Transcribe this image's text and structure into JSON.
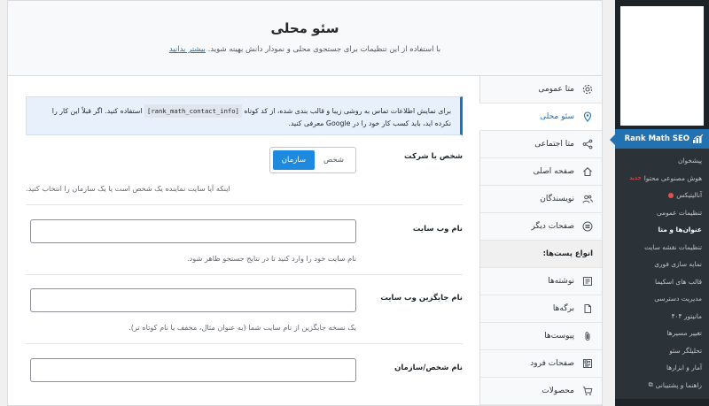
{
  "admin_menu": {
    "plugin_name": "Rank Math SEO",
    "items": [
      {
        "label": "پیشخوان"
      },
      {
        "label": "هوش مصنوعی محتوا",
        "badge": "جدید"
      },
      {
        "label": "آنالیتیکس"
      },
      {
        "label": "تنظیمات عمومی"
      },
      {
        "label": "عنوان‌ها و متا"
      },
      {
        "label": "تنظیمات نقشه سایت"
      },
      {
        "label": "نمایه سازی فوری"
      },
      {
        "label": "قالب های اسکیما"
      },
      {
        "label": "مدیریت دسترسی"
      },
      {
        "label": "مانیتور ۴۰۴"
      },
      {
        "label": "تغییر مسیرها"
      },
      {
        "label": "تحلیلگر سئو"
      },
      {
        "label": "آمار و ابزارها"
      },
      {
        "label": "راهنما و پشتیبانی"
      }
    ]
  },
  "header": {
    "title": "سئو محلی",
    "subtitle": "با استفاده از این تنظیمات برای جستجوی محلی و نمودار دانش بهینه شوید.",
    "learn_more": "بیشتر بدانید"
  },
  "tabs": [
    {
      "label": "متا عمومی",
      "icon": "gear-icon"
    },
    {
      "label": "سئو محلی",
      "icon": "map-pin-icon"
    },
    {
      "label": "متا اجتماعی",
      "icon": "share-icon"
    },
    {
      "label": "صفحه اصلی",
      "icon": "home-icon"
    },
    {
      "label": "نویسندگان",
      "icon": "users-icon"
    },
    {
      "label": "صفحات دیگر",
      "icon": "list-circle-icon"
    },
    {
      "label": "انواع پست‌ها:"
    },
    {
      "label": "نوشته‌ها",
      "icon": "document-icon"
    },
    {
      "label": "برگه‌ها",
      "icon": "page-icon"
    },
    {
      "label": "پیوست‌ها",
      "icon": "paperclip-icon"
    },
    {
      "label": "صفحات فرود",
      "icon": "landing-page-icon"
    },
    {
      "label": "محصولات",
      "icon": "cart-icon"
    }
  ],
  "notice": {
    "text_before": "برای نمایش اطلاعات تماس به روشی زیبا و قالب بندی شده، از کد کوتاه",
    "code": "[rank_math_contact_info]",
    "text_after": "استفاده کنید. اگر قبلاً این کار را نکرده اید، باید کسب کار خود را در Google معرفی کنید."
  },
  "fields": {
    "entity": {
      "label": "شخص یا شرکت",
      "options": [
        "شخص",
        "سازمان"
      ],
      "selected": "سازمان",
      "description": "اینکه آیا سایت نماینده یک شخص است یا یک سازمان را انتخاب کنید."
    },
    "site_name": {
      "label": "نام وب سایت",
      "value": "",
      "description": "نام سایت خود را وارد کنید تا در نتایج جستجو ظاهر شود."
    },
    "alt_site_name": {
      "label": "نام جایگزین وب سایت",
      "value": "",
      "description": "یک نسخه جایگزین از نام سایت شما (به عنوان مثال، مخفف یا نام کوتاه تر)."
    },
    "person_org_name": {
      "label": "نام شخص/سازمان"
    }
  },
  "colors": {
    "accent": "#2271b1",
    "toggle_selected": "#1d8ae0",
    "admin_sidebar": "#1d2327"
  }
}
